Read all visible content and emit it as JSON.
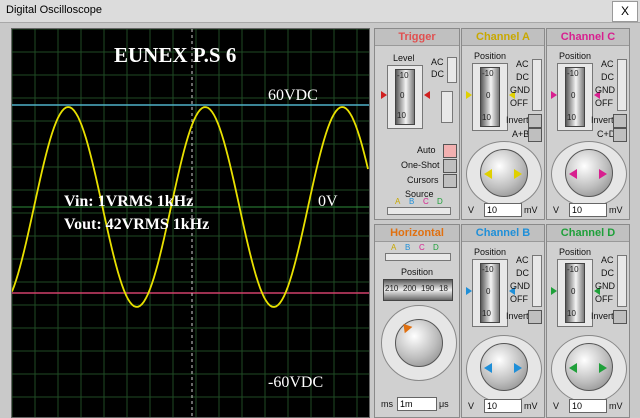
{
  "window": {
    "title": "Digital Oscilloscope",
    "close_label": "X"
  },
  "screen": {
    "title": "EUNEX P.S 6",
    "top_label": "60VDC",
    "mid_label": "0V",
    "bottom_label": "-60VDC",
    "vin_label": "Vin: 1VRMS 1kHz",
    "vout_label": "Vout: 42VRMS 1kHz",
    "trace_color": "#e8e000",
    "top_line_color": "#4fb0c8",
    "bottom_line_color": "#d0406a"
  },
  "trigger": {
    "header": "Trigger",
    "level_label": "Level",
    "level_ticks": [
      "-10",
      "0",
      "10"
    ],
    "ac": "AC",
    "dc": "DC",
    "auto": "Auto",
    "one_shot": "One-Shot",
    "cursors": "Cursors",
    "source_label": "Source",
    "source_options": [
      "A",
      "B",
      "C",
      "D"
    ]
  },
  "horizontal": {
    "header": "Horizontal",
    "source_options": [
      "A",
      "B",
      "C",
      "D"
    ],
    "position_label": "Position",
    "position_ticks": [
      "210",
      "200",
      "190",
      "18"
    ],
    "units": [
      "ms",
      "μs"
    ],
    "scale_value": "1m"
  },
  "channel_a": {
    "header": "Channel A",
    "position_label": "Position",
    "ticks": [
      "-10",
      "0",
      "10"
    ],
    "modes": [
      "AC",
      "DC",
      "GND",
      "OFF"
    ],
    "invert": "Invert",
    "extra": "A+B",
    "scale": "10",
    "unit_left": "V",
    "unit_right": "mV",
    "color": "#e0d000"
  },
  "channel_b": {
    "header": "Channel B",
    "position_label": "Position",
    "ticks": [
      "-10",
      "0",
      "10"
    ],
    "modes": [
      "AC",
      "DC",
      "GND",
      "OFF"
    ],
    "invert": "Invert",
    "scale": "10",
    "unit_left": "V",
    "unit_right": "mV",
    "color": "#1f8fd8"
  },
  "channel_c": {
    "header": "Channel C",
    "position_label": "Position",
    "ticks": [
      "-10",
      "0",
      "10"
    ],
    "modes": [
      "AC",
      "DC",
      "GND",
      "OFF"
    ],
    "invert": "Invert",
    "extra": "C+D",
    "scale": "10",
    "unit_left": "V",
    "unit_right": "mV",
    "color": "#d81f8f"
  },
  "channel_d": {
    "header": "Channel D",
    "position_label": "Position",
    "ticks": [
      "-10",
      "0",
      "10"
    ],
    "modes": [
      "AC",
      "DC",
      "GND",
      "OFF"
    ],
    "invert": "Invert",
    "scale": "10",
    "unit_left": "V",
    "unit_right": "mV",
    "color": "#1fa03a"
  }
}
